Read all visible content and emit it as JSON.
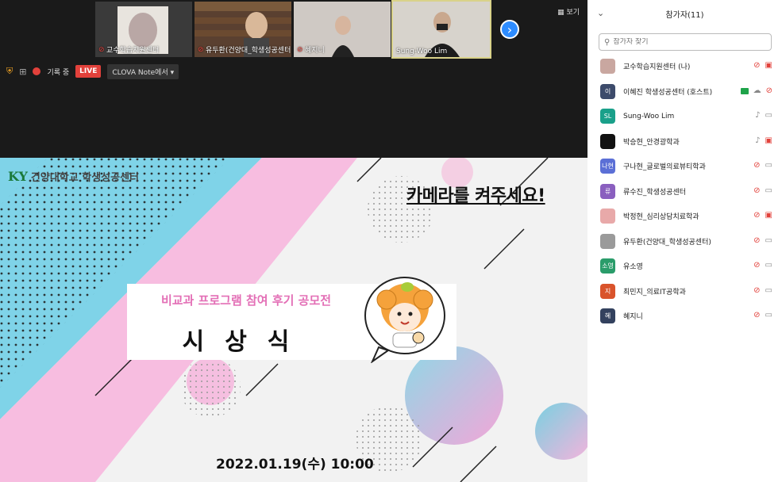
{
  "video_tiles": [
    {
      "name": "교수학습지원센터",
      "muted": true
    },
    {
      "name": "유두환(건양대_학생성공센터)",
      "muted": true
    },
    {
      "name": "혜지니",
      "muted": true
    },
    {
      "name": "Sung-Woo Lim",
      "muted": false
    }
  ],
  "view_label": "보기",
  "toolbar": {
    "rec_label": "기록 중",
    "live_label": "LIVE",
    "clova_label": "CLOVA Note에서 ▾"
  },
  "slide": {
    "logo_mark": "KY",
    "logo_text": "건양대학교 학생성공센터",
    "camera_text": "카메라를 켜주세요!",
    "subtitle": "비교과 프로그램 참여 후기 공모전",
    "main_title": "시상식",
    "date": "2022.01.19(수) 10:00"
  },
  "panel": {
    "title": "참가자(11)",
    "search_placeholder": "참가자 찾기",
    "participants": [
      {
        "name": "교수학습지원센터 (나)",
        "initials": "",
        "color": "#c9a7a0",
        "mic": "muted",
        "cam": "muted",
        "host": false
      },
      {
        "name": "이혜진 학생성공센터 (호스트)",
        "initials": "이",
        "color": "#3d4b6b",
        "mic": "muted",
        "cam": "on",
        "host": true
      },
      {
        "name": "Sung-Woo Lim",
        "initials": "SL",
        "color": "#1aa08a",
        "mic": "on",
        "cam": "on",
        "host": false
      },
      {
        "name": "박승현_안경광학과",
        "initials": "",
        "color": "#111111",
        "mic": "on",
        "cam": "muted",
        "host": false
      },
      {
        "name": "구나현_글로벌의료뷰티학과",
        "initials": "나현",
        "color": "#5b6fd6",
        "mic": "muted",
        "cam": "on",
        "host": false
      },
      {
        "name": "류수진_학생성공센터",
        "initials": "류",
        "color": "#8a5fbf",
        "mic": "muted",
        "cam": "on",
        "host": false
      },
      {
        "name": "박정현_심리상담치료학과",
        "initials": "",
        "color": "#e8a9a9",
        "mic": "muted",
        "cam": "muted",
        "host": false
      },
      {
        "name": "유두환(건양대_학생성공센터)",
        "initials": "",
        "color": "#9a9a9a",
        "mic": "muted",
        "cam": "on",
        "host": false
      },
      {
        "name": "유소영",
        "initials": "소영",
        "color": "#2a9c6a",
        "mic": "muted",
        "cam": "on",
        "host": false
      },
      {
        "name": "최민지_의료IT공학과",
        "initials": "지",
        "color": "#d9532b",
        "mic": "muted",
        "cam": "on",
        "host": false
      },
      {
        "name": "혜지니",
        "initials": "혜",
        "color": "#33415e",
        "mic": "muted",
        "cam": "on",
        "host": false
      }
    ]
  }
}
